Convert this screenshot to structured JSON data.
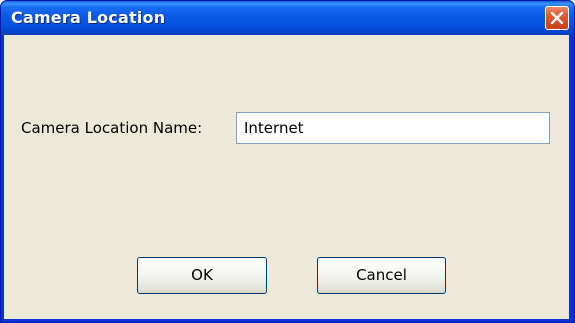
{
  "window": {
    "title": "Camera Location"
  },
  "form": {
    "name_label": "Camera Location Name:",
    "name_value": "Internet"
  },
  "buttons": {
    "ok_label": "OK",
    "cancel_label": "Cancel"
  },
  "icons": {
    "close": "close-icon"
  },
  "colors": {
    "titlebar": "#0553e0",
    "close_button": "#dc5a32",
    "dialog_face": "#ece9d8",
    "input_border": "#7f9db9",
    "button_border": "#003c74"
  }
}
